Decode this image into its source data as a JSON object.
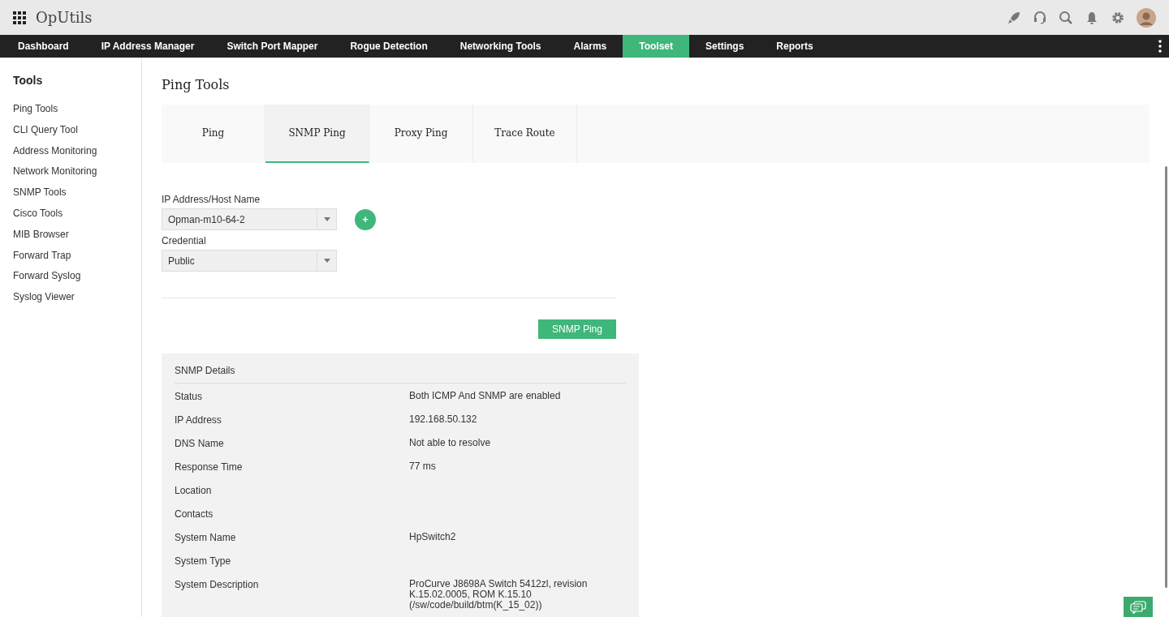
{
  "app": {
    "title": "OpUtils"
  },
  "nav": [
    {
      "label": "Dashboard",
      "selected": false
    },
    {
      "label": "IP Address Manager",
      "selected": false
    },
    {
      "label": "Switch Port Mapper",
      "selected": false
    },
    {
      "label": "Rogue Detection",
      "selected": false
    },
    {
      "label": "Networking Tools",
      "selected": false
    },
    {
      "label": "Alarms",
      "selected": false
    },
    {
      "label": "Toolset",
      "selected": true
    },
    {
      "label": "Settings",
      "selected": false
    },
    {
      "label": "Reports",
      "selected": false
    }
  ],
  "sidebar": {
    "title": "Tools",
    "items": [
      "Ping Tools",
      "CLI Query Tool",
      "Address Monitoring",
      "Network Monitoring",
      "SNMP Tools",
      "Cisco Tools",
      "MIB Browser",
      "Forward Trap",
      "Forward Syslog",
      "Syslog Viewer"
    ]
  },
  "page_title": "Ping Tools",
  "tabs": [
    {
      "label": "Ping",
      "selected": false
    },
    {
      "label": "SNMP Ping",
      "selected": true
    },
    {
      "label": "Proxy Ping",
      "selected": false
    },
    {
      "label": "Trace Route",
      "selected": false
    }
  ],
  "form": {
    "host_label": "IP Address/Host Name",
    "host_value": "Opman-m10-64-2",
    "credential_label": "Credential",
    "credential_value": "Public",
    "add_button": "+",
    "submit_button": "SNMP Ping"
  },
  "details": {
    "title": "SNMP Details",
    "rows": [
      {
        "label": "Status",
        "value": "Both ICMP And SNMP are enabled"
      },
      {
        "label": "IP Address",
        "value": "192.168.50.132"
      },
      {
        "label": "DNS Name",
        "value": "Not able to resolve"
      },
      {
        "label": "Response Time",
        "value": "77 ms"
      },
      {
        "label": "Location",
        "value": ""
      },
      {
        "label": "Contacts",
        "value": ""
      },
      {
        "label": "System Name",
        "value": "HpSwitch2"
      },
      {
        "label": "System Type",
        "value": ""
      },
      {
        "label": "System Description",
        "value": "ProCurve J8698A Switch 5412zl, revision K.15.02.0005, ROM K.15.10 (/sw/code/build/btm(K_15_02))"
      }
    ]
  }
}
